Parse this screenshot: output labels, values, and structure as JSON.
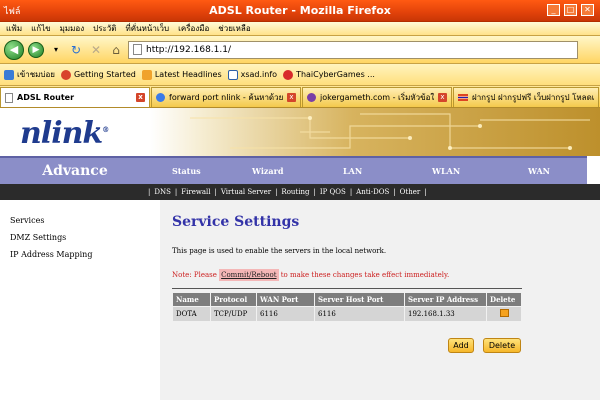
{
  "window": {
    "title": "ADSL Router - Mozilla Firefox",
    "menu_label": "ไฟล์"
  },
  "menubar": [
    "แฟ้ม",
    "แก้ไข",
    "มุมมอง",
    "ประวัติ",
    "ที่คั่นหน้าเว็บ",
    "เครื่องมือ",
    "ช่วยเหลือ"
  ],
  "navbar": {
    "url": "http://192.168.1.1/"
  },
  "bookmarks": [
    {
      "label": "เข้าชมบ่อย",
      "color": "#3a7cd6"
    },
    {
      "label": "Getting Started",
      "color": "#d8432b"
    },
    {
      "label": "Latest Headlines",
      "color": "#f0a22b"
    },
    {
      "label": "xsad.info",
      "color": "#2c5fa8"
    },
    {
      "label": "ThaiCyberGames ...",
      "color": "#d82b2b"
    }
  ],
  "tabs": [
    {
      "label": "ADSL Router",
      "active": true
    },
    {
      "label": "forward port nlink - ค้นหาด้วย Goo...",
      "active": false
    },
    {
      "label": "jokergameth.com - เริ่มหัวข้อใหม่",
      "active": false
    },
    {
      "label": "ฝากรูป ฝากรูปฟรี เว็บฝากรูป โหลดเร็วที่",
      "active": false
    }
  ],
  "logo": {
    "text": "nlink",
    "mark": "®"
  },
  "nav": {
    "section": "Advance",
    "items": [
      "Status",
      "Wizard",
      "LAN",
      "WLAN",
      "WAN"
    ],
    "sub": [
      "DNS",
      "Firewall",
      "Virtual Server",
      "Routing",
      "IP QOS",
      "Anti-DOS",
      "Other"
    ]
  },
  "sidebar": [
    "Services",
    "DMZ Settings",
    "IP Address Mapping"
  ],
  "main": {
    "title": "Service Settings",
    "description": "This page is used to enable the servers in the local network.",
    "note_prefix": "Note: Please ",
    "note_link": "Commit/Reboot",
    "note_suffix": " to make these changes take effect immediately.",
    "table": {
      "headers": [
        "Name",
        "Protocol",
        "WAN Port",
        "Server Host Port",
        "Server IP Address",
        "Delete"
      ],
      "rows": [
        [
          "DOTA",
          "TCP/UDP",
          "6116",
          "6116",
          "192.168.1.33",
          ""
        ]
      ]
    },
    "add_label": "Add",
    "delete_label": "Delete"
  }
}
